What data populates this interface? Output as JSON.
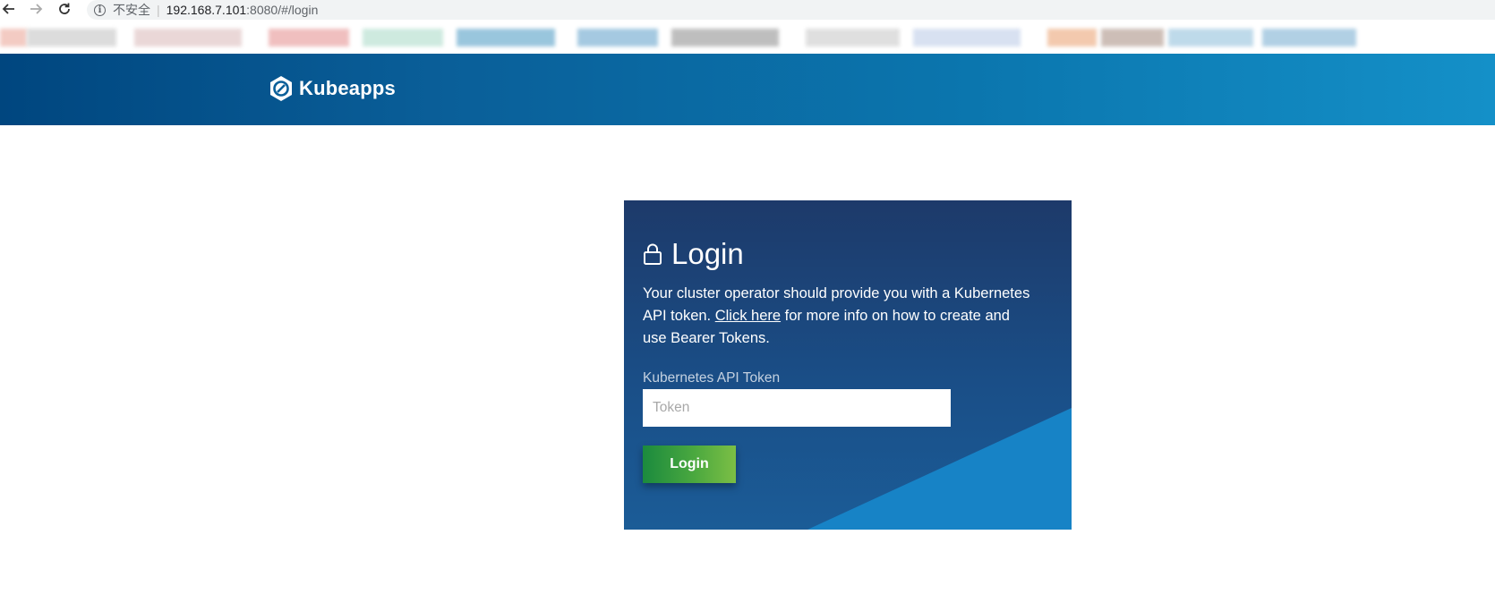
{
  "browser": {
    "back_icon": "back-arrow-icon",
    "forward_icon": "forward-arrow-icon",
    "reload_icon": "reload-icon",
    "security_label": "不安全",
    "url_host": "192.168.7.101",
    "url_rest": ":8080/#/login"
  },
  "header": {
    "app_name": "Kubeapps",
    "logo_icon": "kubeapps-hexagon-icon",
    "gradient_start": "#00467f",
    "gradient_end": "#1490c8"
  },
  "login": {
    "title": "Login",
    "description_before_link": "Your cluster operator should provide you with a Kubernetes API token. ",
    "link_text": "Click here",
    "description_after_link": " for more info on how to create and use Bearer Tokens.",
    "token_label": "Kubernetes API Token",
    "token_placeholder": "Token",
    "token_value": "",
    "button_label": "Login",
    "card_color": "#1d3a6a",
    "triangle_color": "#1783c6",
    "button_color": "#4aa83f"
  }
}
